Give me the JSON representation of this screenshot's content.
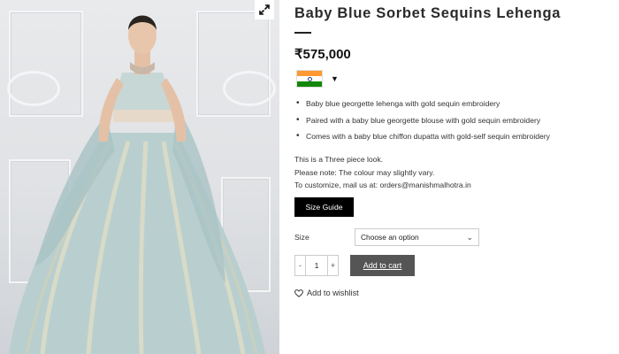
{
  "product": {
    "title": "Baby Blue Sorbet Sequins Lehenga",
    "price": "₹575,000",
    "features": [
      "Baby blue georgette lehenga with gold sequin embroidery",
      "Paired with a baby blue georgette blouse with gold sequin embroidery",
      "Comes with a baby blue chiffon dupatta with gold-self sequin embroidery"
    ],
    "notes": [
      "This is a Three piece look.",
      "Please note: The colour may slightly vary.",
      "To customize, mail us at: orders@manishmalhotra.in"
    ]
  },
  "currency": {
    "flag_icon": "india-flag-icon",
    "caret": "▼",
    "colors": {
      "saffron": "#ff9933",
      "white": "#ffffff",
      "green": "#138808",
      "chakra": "#1e3a8a"
    }
  },
  "actions": {
    "size_guide_label": "Size Guide",
    "size_label": "Size",
    "size_select_value": "Choose an option",
    "qty_minus": "-",
    "qty_value": "1",
    "qty_plus": "+",
    "add_to_cart_label": "Add to cart",
    "wishlist_label": "Add to wishlist"
  },
  "gallery": {
    "zoom_icon": "expand-icon",
    "image_subject": "model-in-lehenga-photo"
  },
  "colors": {
    "size_guide_bg": "#000000",
    "add_to_cart_bg": "#555555",
    "dress": "#b8cfce",
    "sequin": "#d9d4b8"
  }
}
